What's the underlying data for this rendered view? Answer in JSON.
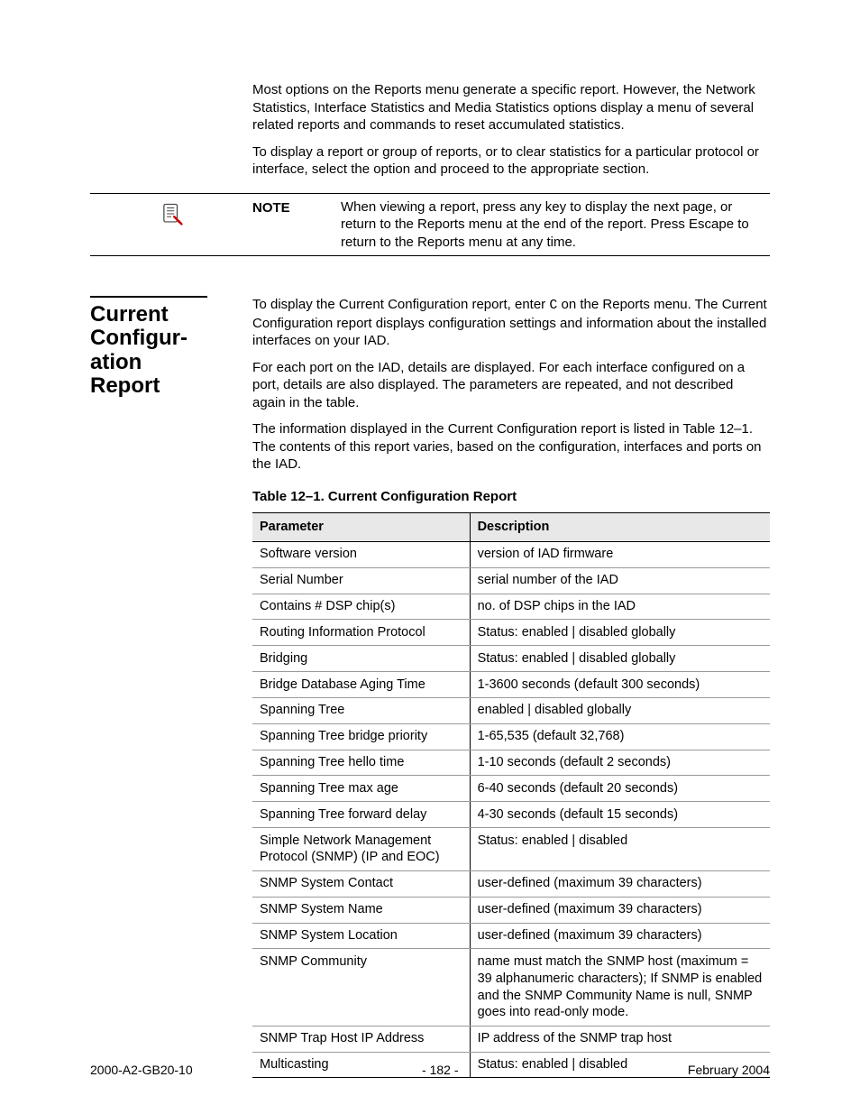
{
  "intro": {
    "p1": "Most options on the Reports menu generate a specific report. However, the Network Statistics, Interface Statistics and Media Statistics options display a menu of several related reports and commands to reset accumulated statistics.",
    "p2": "To display a report or group of reports, or to clear statistics for a particular protocol or interface, select the option and proceed to the appropriate section."
  },
  "note": {
    "label": "NOTE",
    "text": "When viewing a report, press any key to display the next page, or return to the Reports menu at the end of the report. Press Escape to return to the Reports menu at any time."
  },
  "section": {
    "heading": "Current Configur-ation Report",
    "p1a": "To display the Current Configuration report, enter ",
    "p1key": "C",
    "p1b": " on the Reports menu. The Current Configuration report displays configuration settings and information about the installed interfaces on your IAD.",
    "p2": "For each port on the IAD, details are displayed. For each interface configured on a port, details are also displayed. The parameters are repeated, and not described again in the table.",
    "p3": "The information displayed in the Current Configuration report is listed in Table 12–1. The contents of this report varies, based on the configuration, interfaces and ports on the IAD."
  },
  "table": {
    "caption": "Table 12–1.  Current Configuration Report",
    "headers": {
      "col1": "Parameter",
      "col2": "Description"
    },
    "rows": [
      {
        "p": "Software version",
        "d": "version of IAD firmware"
      },
      {
        "p": "Serial Number",
        "d": "serial number of the IAD"
      },
      {
        "p": "Contains # DSP chip(s)",
        "d": "no. of DSP chips in the IAD"
      },
      {
        "p": "Routing Information Protocol",
        "d": "Status: enabled | disabled globally"
      },
      {
        "p": "Bridging",
        "d": "Status: enabled | disabled globally"
      },
      {
        "p": "Bridge Database Aging Time",
        "d": "1-3600 seconds (default 300 seconds)"
      },
      {
        "p": "Spanning Tree",
        "d": "enabled | disabled globally"
      },
      {
        "p": "Spanning Tree bridge priority",
        "d": "1-65,535 (default 32,768)"
      },
      {
        "p": "Spanning Tree hello time",
        "d": "1-10 seconds (default 2 seconds)"
      },
      {
        "p": "Spanning Tree max age",
        "d": "6-40 seconds (default 20 seconds)"
      },
      {
        "p": "Spanning Tree forward delay",
        "d": "4-30 seconds (default 15 seconds)"
      },
      {
        "p": "Simple Network Management Protocol (SNMP) (IP and EOC)",
        "d": "Status: enabled | disabled"
      },
      {
        "p": "SNMP System Contact",
        "d": "user-defined (maximum 39 characters)"
      },
      {
        "p": "SNMP System Name",
        "d": "user-defined (maximum 39 characters)"
      },
      {
        "p": "SNMP System Location",
        "d": "user-defined (maximum 39 characters)"
      },
      {
        "p": "SNMP Community",
        "d": "name must match the SNMP host (maximum = 39 alphanumeric characters); If SNMP is enabled and the SNMP Community Name is null, SNMP goes into read-only mode."
      },
      {
        "p": "SNMP Trap Host IP Address",
        "d": "IP address of the SNMP trap host"
      },
      {
        "p": "Multicasting",
        "d": "Status: enabled | disabled"
      }
    ]
  },
  "footer": {
    "left": "2000-A2-GB20-10",
    "center": "- 182 -",
    "right": "February 2004"
  }
}
